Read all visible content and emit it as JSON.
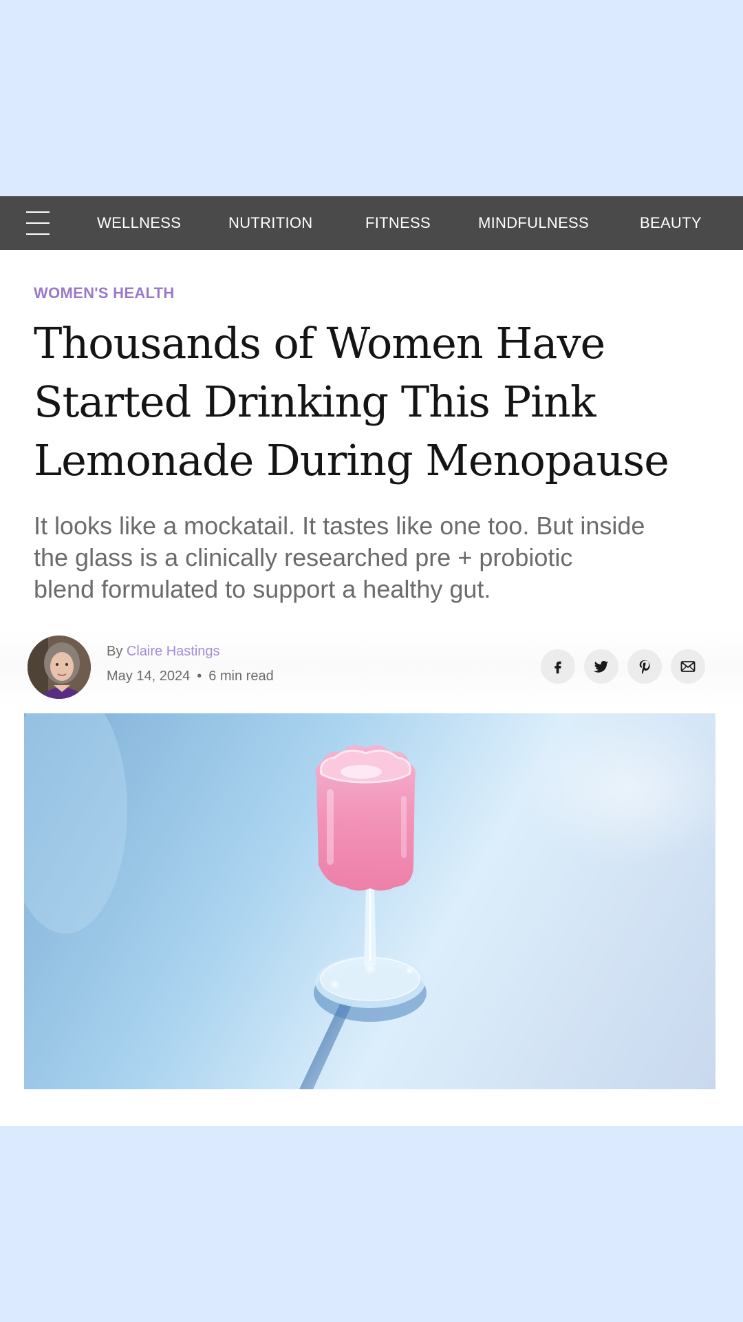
{
  "nav": {
    "items": [
      "WELLNESS",
      "NUTRITION",
      "FITNESS",
      "MINDFULNESS",
      "BEAUTY"
    ]
  },
  "article": {
    "category": "WOMEN'S HEALTH",
    "headline_lines": [
      "Thousands of Women Have",
      "Started Drinking This Pink",
      "Lemonade During Menopause"
    ],
    "dek_lines": [
      "It looks like a mockatail. It tastes like one too. But inside",
      "the glass is a clinically researched pre + probiotic",
      "blend formulated to support a healthy gut."
    ],
    "byline": {
      "prefix": "By",
      "author": "Claire Hastings",
      "date": "May 14, 2024",
      "separator": "•",
      "read_time": "6 min read"
    },
    "share_icons": [
      "facebook-icon",
      "twitter-icon",
      "pinterest-icon",
      "email-icon"
    ]
  },
  "colors": {
    "page_bg": "#dbeafe",
    "nav_bg": "#4a4a4a",
    "accent": "#9a79c9",
    "author_link": "#a58bd6",
    "headline": "#141414",
    "dek": "#6b6b6b"
  }
}
